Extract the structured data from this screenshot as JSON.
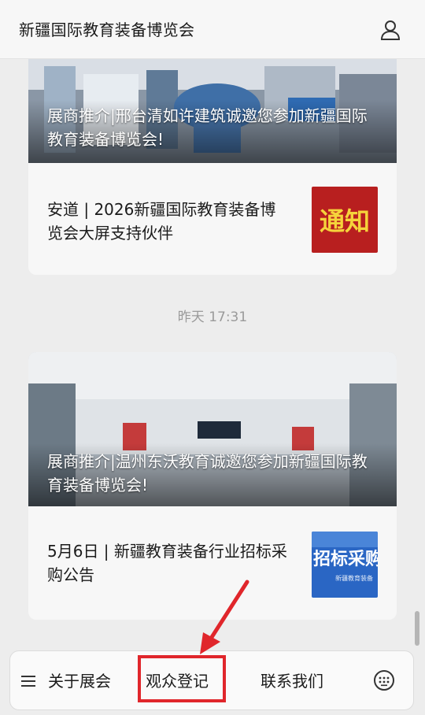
{
  "header": {
    "title": "新疆国际教育装备博览会"
  },
  "feed": [
    {
      "hero_caption": "展商推介|邢台清如许建筑诚邀您参加新疆国际教育装备博览会!",
      "sub_title": "安道 | 2026新疆国际教育装备博览会大屏支持伙伴",
      "thumb_text": "通知"
    },
    {
      "hero_caption": "展商推介|温州东沃教育诚邀您参加新疆国际教育装备博览会!",
      "sub_title": "5月6日 | 新疆教育装备行业招标采购公告",
      "thumb_text": "招标采购",
      "thumb_subtext": "新疆教育装备"
    }
  ],
  "timestamp": "昨天 17:31",
  "bottom_nav": {
    "about": "关于展会",
    "register": "观众登记",
    "contact": "联系我们"
  },
  "colors": {
    "highlight": "#e0262b",
    "thumb_notice_bg": "#b81f1f",
    "thumb_notice_text": "#f5d33b",
    "thumb_bid_bg": "#2a66c4"
  },
  "icons": [
    "user-icon",
    "menu-icon",
    "keyboard-icon",
    "arrow-annotation"
  ]
}
